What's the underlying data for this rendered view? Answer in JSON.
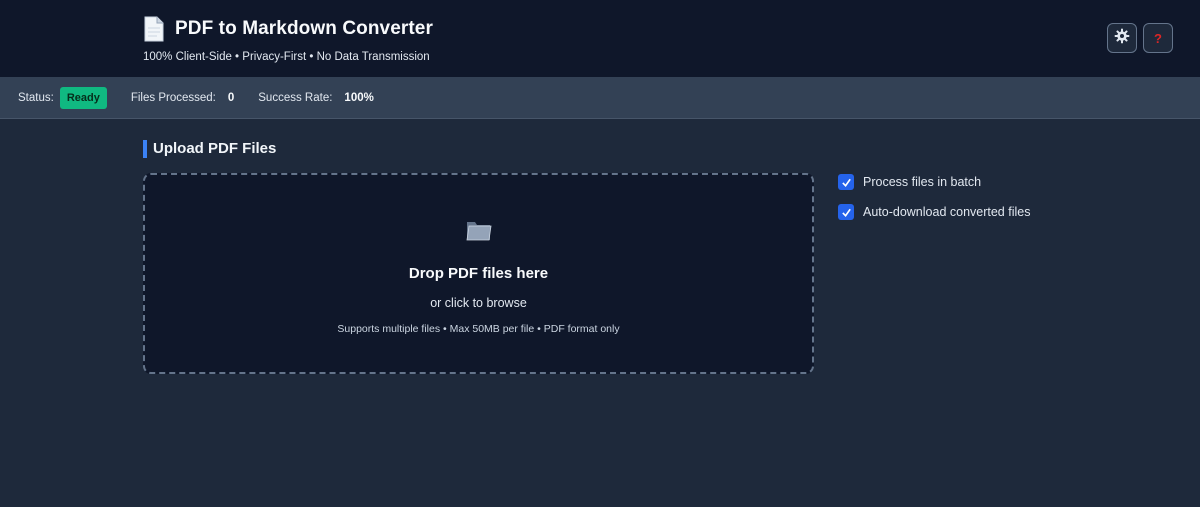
{
  "header": {
    "title": "PDF to Markdown Converter",
    "subtitle": "100% Client-Side • Privacy-First • No Data Transmission",
    "buttons": {
      "settings_icon": "gear-icon",
      "help_glyph": "?"
    }
  },
  "status": {
    "status_label": "Status:",
    "status_value": "Ready",
    "files_label": "Files Processed:",
    "files_value": "0",
    "success_label": "Success Rate:",
    "success_value": "100%"
  },
  "upload": {
    "section_title": "Upload PDF Files",
    "drop_title": "Drop PDF files here",
    "drop_sub": "or click to browse",
    "drop_hint": "Supports multiple files • Max 50MB per file • PDF format only"
  },
  "options": [
    {
      "label": "Process files in batch",
      "checked": true
    },
    {
      "label": "Auto-download converted files",
      "checked": true
    }
  ],
  "colors": {
    "header_bg": "#0f172a",
    "page_bg": "#1e293b",
    "status_bar_bg": "#334155",
    "accent": "#3b82f6",
    "ready_badge": "#10b981",
    "checkbox": "#2563eb"
  }
}
